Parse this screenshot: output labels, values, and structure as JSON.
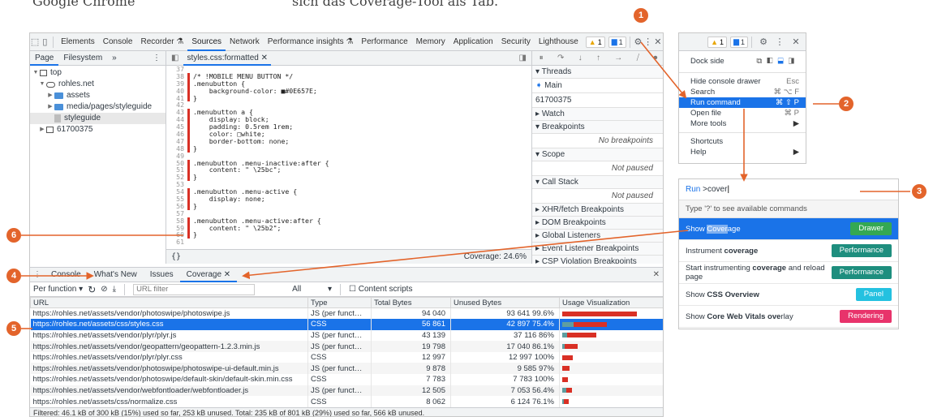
{
  "book": {
    "left_caption": "Google Chrome",
    "center_caption": "sich das Coverage-Tool als Tab."
  },
  "toolbar": {
    "tabs": [
      "Elements",
      "Console",
      "Recorder",
      "Sources",
      "Network",
      "Performance insights",
      "Performance",
      "Memory",
      "Application",
      "Security",
      "Lighthouse"
    ],
    "warn_count": "1",
    "info_count": "1"
  },
  "navigator": {
    "tabs": [
      "Page",
      "Filesystem"
    ],
    "items": [
      "top",
      "rohles.net",
      "assets",
      "media/pages/styleguide",
      "styleguide",
      "61700375"
    ]
  },
  "editor": {
    "tab": "styles.css:formatted",
    "lines": [
      {
        "n": "37",
        "t": "",
        "m": false
      },
      {
        "n": "38",
        "t": "/* !MOBILE MENU BUTTON */",
        "m": true
      },
      {
        "n": "39",
        "t": ".menubutton {",
        "m": true
      },
      {
        "n": "40",
        "t": "    background-color: ■#0E657E;",
        "m": true
      },
      {
        "n": "41",
        "t": "}",
        "m": true
      },
      {
        "n": "42",
        "t": "",
        "m": false
      },
      {
        "n": "43",
        "t": ".menubutton a {",
        "m": true
      },
      {
        "n": "44",
        "t": "    display: block;",
        "m": true
      },
      {
        "n": "45",
        "t": "    padding: 0.5rem 1rem;",
        "m": true
      },
      {
        "n": "46",
        "t": "    color: □white;",
        "m": true
      },
      {
        "n": "47",
        "t": "    border-bottom: none;",
        "m": true
      },
      {
        "n": "48",
        "t": "}",
        "m": true
      },
      {
        "n": "49",
        "t": "",
        "m": false
      },
      {
        "n": "50",
        "t": ".menubutton .menu-inactive:after {",
        "m": true
      },
      {
        "n": "51",
        "t": "    content: \" \\25bc\";",
        "m": true
      },
      {
        "n": "52",
        "t": "}",
        "m": true
      },
      {
        "n": "53",
        "t": "",
        "m": false
      },
      {
        "n": "54",
        "t": ".menubutton .menu-active {",
        "m": true
      },
      {
        "n": "55",
        "t": "    display: none;",
        "m": true
      },
      {
        "n": "56",
        "t": "}",
        "m": true
      },
      {
        "n": "57",
        "t": "",
        "m": false
      },
      {
        "n": "58",
        "t": ".menubutton .menu-active:after {",
        "m": true
      },
      {
        "n": "59",
        "t": "    content: \" \\25b2\";",
        "m": true
      },
      {
        "n": "60",
        "t": "}",
        "m": true
      },
      {
        "n": "61",
        "t": "",
        "m": false
      }
    ],
    "footer_left": "{}",
    "coverage": "Coverage: 24.6%"
  },
  "debugger": {
    "threads": "Threads",
    "main": "Main",
    "thread_id": "61700375",
    "watch": "Watch",
    "breakpoints": "Breakpoints",
    "no_breakpoints": "No breakpoints",
    "scope": "Scope",
    "not_paused": "Not paused",
    "call_stack": "Call Stack",
    "not_paused2": "Not paused",
    "others": [
      "XHR/fetch Breakpoints",
      "DOM Breakpoints",
      "Global Listeners",
      "Event Listener Breakpoints",
      "CSP Violation Breakpoints"
    ]
  },
  "drawer": {
    "tabs": [
      "Console",
      "What's New",
      "Issues",
      "Coverage"
    ],
    "per_function": "Per function",
    "filter_placeholder": "URL filter",
    "type_filter": "All",
    "content_scripts": "Content scripts",
    "headers": [
      "URL",
      "Type",
      "Total Bytes",
      "Unused Bytes",
      "Usage Visualization"
    ],
    "rows": [
      {
        "url": "https://rohles.net/assets/vendor/photoswipe/photoswipe.js",
        "type": "JS (per funct…",
        "total": "94 040",
        "unused": "93 641 99.6%",
        "u": 0.996,
        "t": 1.0
      },
      {
        "url": "https://rohles.net/assets/css/styles.css",
        "type": "CSS",
        "total": "56 861",
        "unused": "42 897 75.4%",
        "u": 0.754,
        "t": 0.6
      },
      {
        "url": "https://rohles.net/assets/vendor/plyr/plyr.js",
        "type": "JS (per funct…",
        "total": "43 139",
        "unused": "37 116  86%",
        "u": 0.86,
        "t": 0.46
      },
      {
        "url": "https://rohles.net/assets/vendor/geopattern/geopattern-1.2.3.min.js",
        "type": "JS (per funct…",
        "total": "19 798",
        "unused": "17 040 86.1%",
        "u": 0.861,
        "t": 0.21
      },
      {
        "url": "https://rohles.net/assets/vendor/plyr/plyr.css",
        "type": "CSS",
        "total": "12 997",
        "unused": "12 997 100%",
        "u": 1.0,
        "t": 0.14
      },
      {
        "url": "https://rohles.net/assets/vendor/photoswipe/photoswipe-ui-default.min.js",
        "type": "JS (per funct…",
        "total": "9 878",
        "unused": "9 585  97%",
        "u": 0.97,
        "t": 0.1
      },
      {
        "url": "https://rohles.net/assets/vendor/photoswipe/default-skin/default-skin.min.css",
        "type": "CSS",
        "total": "7 783",
        "unused": "7 783 100%",
        "u": 1.0,
        "t": 0.08
      },
      {
        "url": "https://rohles.net/assets/vendor/webfontloader/webfontloader.js",
        "type": "JS (per funct…",
        "total": "12 505",
        "unused": "7 053 56.4%",
        "u": 0.564,
        "t": 0.13
      },
      {
        "url": "https://rohles.net/assets/css/normalize.css",
        "type": "CSS",
        "total": "8 062",
        "unused": "6 124 76.1%",
        "u": 0.761,
        "t": 0.09
      }
    ],
    "status": "Filtered: 46.1 kB of 300 kB (15%) used so far, 253 kB unused. Total: 235 kB of 801 kB (29%) used so far, 566 kB unused."
  },
  "menu": {
    "dock_side": "Dock side",
    "items": [
      {
        "label": "Hide console drawer",
        "sc": "Esc"
      },
      {
        "label": "Search",
        "sc": "⌘ ⌥ F"
      },
      {
        "label": "Run command",
        "sc": "⌘ ⇧ P"
      },
      {
        "label": "Open file",
        "sc": "⌘ P"
      },
      {
        "label": "More tools",
        "sc": "▶"
      },
      {
        "label": "Shortcuts",
        "sc": ""
      },
      {
        "label": "Help",
        "sc": "▶"
      }
    ]
  },
  "command": {
    "prefix": "Run",
    "query": ">cover",
    "hint": "Type '?' to see available commands",
    "items": [
      {
        "pre": "Show ",
        "bold": "Cover",
        "post": "age",
        "tag": "Drawer",
        "color": "#34a853"
      },
      {
        "pre": "Instrument ",
        "bold": "coverage",
        "post": "",
        "tag": "Performance",
        "color": "#1e8e7e"
      },
      {
        "pre": "Start instrumenting ",
        "bold": "coverage",
        "post": " and reload page",
        "tag": "Performance",
        "color": "#1e8e7e"
      },
      {
        "pre": "Show ",
        "bold": "CSS Overview",
        "post": "",
        "tag": "Panel",
        "color": "#24c1e0"
      },
      {
        "pre": "Show ",
        "bold": "Core Web Vitals ove",
        "post": "rlay",
        "tag": "Rendering",
        "color": "#e8336b"
      }
    ]
  },
  "callouts": [
    "1",
    "2",
    "3",
    "4",
    "5",
    "6"
  ],
  "colors": {
    "accent": "#1a73e8",
    "callout": "#e3642b",
    "unused_bar": "#d93025",
    "used_bar": "#5f9ea0"
  }
}
